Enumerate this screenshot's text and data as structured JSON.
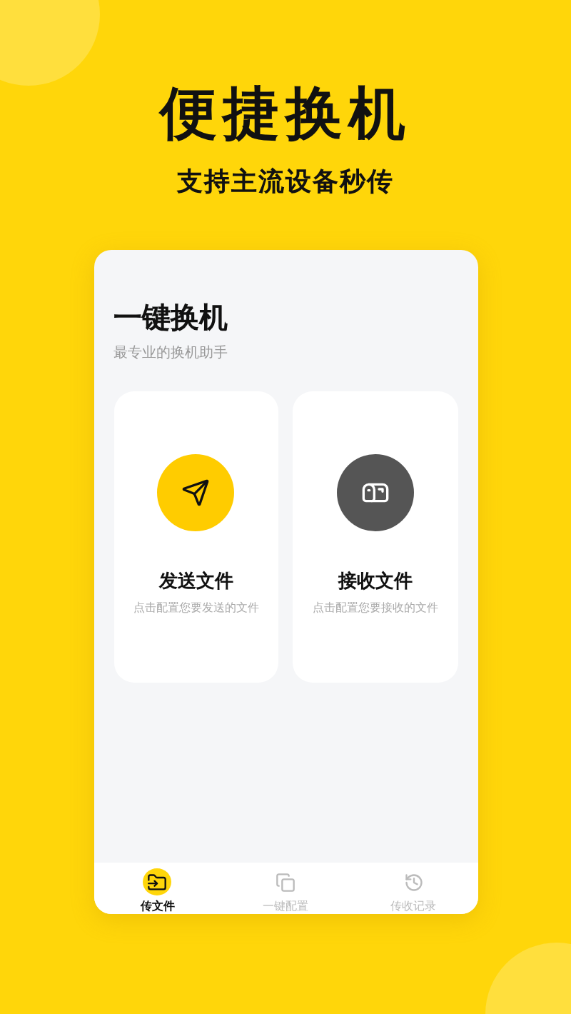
{
  "headline": "便捷换机",
  "tagline": "支持主流设备秒传",
  "app": {
    "title": "一键换机",
    "subtitle": "最专业的换机助手",
    "actions": [
      {
        "kind": "send",
        "title": "发送文件",
        "description": "点击配置您要发送的文件"
      },
      {
        "kind": "receive",
        "title": "接收文件",
        "description": "点击配置您要接收的文件"
      }
    ],
    "tabs": [
      {
        "kind": "transfer",
        "label": "传文件",
        "selected": true
      },
      {
        "kind": "config",
        "label": "一键配置",
        "selected": false
      },
      {
        "kind": "history",
        "label": "传收记录",
        "selected": false
      }
    ]
  }
}
